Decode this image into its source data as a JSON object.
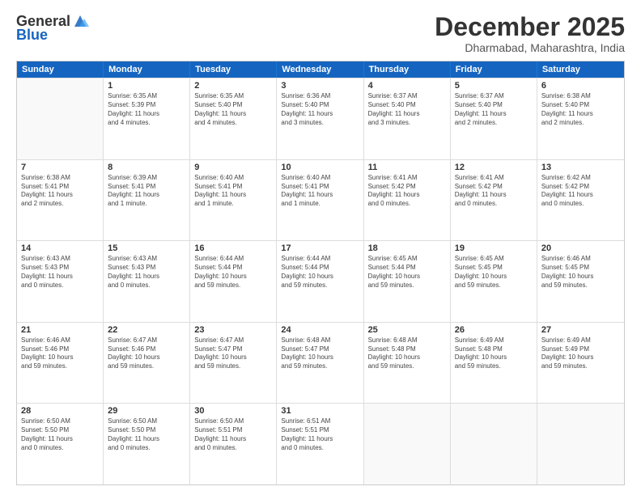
{
  "logo": {
    "general": "General",
    "blue": "Blue"
  },
  "title": "December 2025",
  "location": "Dharmabad, Maharashtra, India",
  "header_days": [
    "Sunday",
    "Monday",
    "Tuesday",
    "Wednesday",
    "Thursday",
    "Friday",
    "Saturday"
  ],
  "weeks": [
    [
      {
        "day": "",
        "info": ""
      },
      {
        "day": "1",
        "info": "Sunrise: 6:35 AM\nSunset: 5:39 PM\nDaylight: 11 hours\nand 4 minutes."
      },
      {
        "day": "2",
        "info": "Sunrise: 6:35 AM\nSunset: 5:40 PM\nDaylight: 11 hours\nand 4 minutes."
      },
      {
        "day": "3",
        "info": "Sunrise: 6:36 AM\nSunset: 5:40 PM\nDaylight: 11 hours\nand 3 minutes."
      },
      {
        "day": "4",
        "info": "Sunrise: 6:37 AM\nSunset: 5:40 PM\nDaylight: 11 hours\nand 3 minutes."
      },
      {
        "day": "5",
        "info": "Sunrise: 6:37 AM\nSunset: 5:40 PM\nDaylight: 11 hours\nand 2 minutes."
      },
      {
        "day": "6",
        "info": "Sunrise: 6:38 AM\nSunset: 5:40 PM\nDaylight: 11 hours\nand 2 minutes."
      }
    ],
    [
      {
        "day": "7",
        "info": "Sunrise: 6:38 AM\nSunset: 5:41 PM\nDaylight: 11 hours\nand 2 minutes."
      },
      {
        "day": "8",
        "info": "Sunrise: 6:39 AM\nSunset: 5:41 PM\nDaylight: 11 hours\nand 1 minute."
      },
      {
        "day": "9",
        "info": "Sunrise: 6:40 AM\nSunset: 5:41 PM\nDaylight: 11 hours\nand 1 minute."
      },
      {
        "day": "10",
        "info": "Sunrise: 6:40 AM\nSunset: 5:41 PM\nDaylight: 11 hours\nand 1 minute."
      },
      {
        "day": "11",
        "info": "Sunrise: 6:41 AM\nSunset: 5:42 PM\nDaylight: 11 hours\nand 0 minutes."
      },
      {
        "day": "12",
        "info": "Sunrise: 6:41 AM\nSunset: 5:42 PM\nDaylight: 11 hours\nand 0 minutes."
      },
      {
        "day": "13",
        "info": "Sunrise: 6:42 AM\nSunset: 5:42 PM\nDaylight: 11 hours\nand 0 minutes."
      }
    ],
    [
      {
        "day": "14",
        "info": "Sunrise: 6:43 AM\nSunset: 5:43 PM\nDaylight: 11 hours\nand 0 minutes."
      },
      {
        "day": "15",
        "info": "Sunrise: 6:43 AM\nSunset: 5:43 PM\nDaylight: 11 hours\nand 0 minutes."
      },
      {
        "day": "16",
        "info": "Sunrise: 6:44 AM\nSunset: 5:44 PM\nDaylight: 10 hours\nand 59 minutes."
      },
      {
        "day": "17",
        "info": "Sunrise: 6:44 AM\nSunset: 5:44 PM\nDaylight: 10 hours\nand 59 minutes."
      },
      {
        "day": "18",
        "info": "Sunrise: 6:45 AM\nSunset: 5:44 PM\nDaylight: 10 hours\nand 59 minutes."
      },
      {
        "day": "19",
        "info": "Sunrise: 6:45 AM\nSunset: 5:45 PM\nDaylight: 10 hours\nand 59 minutes."
      },
      {
        "day": "20",
        "info": "Sunrise: 6:46 AM\nSunset: 5:45 PM\nDaylight: 10 hours\nand 59 minutes."
      }
    ],
    [
      {
        "day": "21",
        "info": "Sunrise: 6:46 AM\nSunset: 5:46 PM\nDaylight: 10 hours\nand 59 minutes."
      },
      {
        "day": "22",
        "info": "Sunrise: 6:47 AM\nSunset: 5:46 PM\nDaylight: 10 hours\nand 59 minutes."
      },
      {
        "day": "23",
        "info": "Sunrise: 6:47 AM\nSunset: 5:47 PM\nDaylight: 10 hours\nand 59 minutes."
      },
      {
        "day": "24",
        "info": "Sunrise: 6:48 AM\nSunset: 5:47 PM\nDaylight: 10 hours\nand 59 minutes."
      },
      {
        "day": "25",
        "info": "Sunrise: 6:48 AM\nSunset: 5:48 PM\nDaylight: 10 hours\nand 59 minutes."
      },
      {
        "day": "26",
        "info": "Sunrise: 6:49 AM\nSunset: 5:48 PM\nDaylight: 10 hours\nand 59 minutes."
      },
      {
        "day": "27",
        "info": "Sunrise: 6:49 AM\nSunset: 5:49 PM\nDaylight: 10 hours\nand 59 minutes."
      }
    ],
    [
      {
        "day": "28",
        "info": "Sunrise: 6:50 AM\nSunset: 5:50 PM\nDaylight: 11 hours\nand 0 minutes."
      },
      {
        "day": "29",
        "info": "Sunrise: 6:50 AM\nSunset: 5:50 PM\nDaylight: 11 hours\nand 0 minutes."
      },
      {
        "day": "30",
        "info": "Sunrise: 6:50 AM\nSunset: 5:51 PM\nDaylight: 11 hours\nand 0 minutes."
      },
      {
        "day": "31",
        "info": "Sunrise: 6:51 AM\nSunset: 5:51 PM\nDaylight: 11 hours\nand 0 minutes."
      },
      {
        "day": "",
        "info": ""
      },
      {
        "day": "",
        "info": ""
      },
      {
        "day": "",
        "info": ""
      }
    ]
  ]
}
